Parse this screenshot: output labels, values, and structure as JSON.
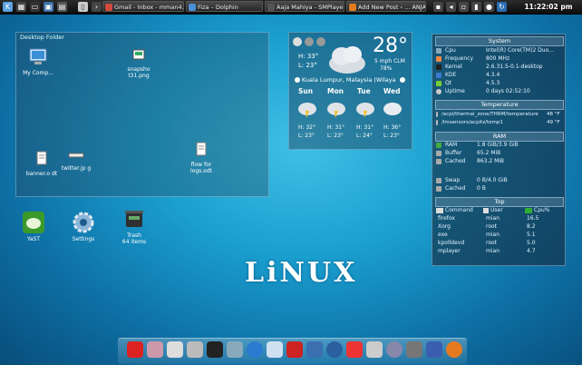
{
  "taskbar": {
    "tasks": [
      {
        "label": "Gmail - Inbox - mman4...",
        "color": "#d04a3a"
      },
      {
        "label": "Fiza – Dolphin",
        "color": "#4a90d9"
      },
      {
        "label": "Aaja Mahiya - SMPlayer",
        "color": "#3a3a3a"
      },
      {
        "label": "Add New Post ‹ ... ANJA",
        "color": "#e07a20"
      }
    ],
    "clock": "11:22:02 pm"
  },
  "folder": {
    "title": "Desktop Folder",
    "items": [
      {
        "label": "My Comp...",
        "icon": "computer-icon"
      },
      {
        "label": "snapsho t31.png",
        "icon": "image-file-icon"
      },
      {
        "label": "banner.o dt",
        "icon": "document-icon"
      },
      {
        "label": "twitter.jp g",
        "icon": "image-file-icon"
      },
      {
        "label": "flow for logs.odt",
        "icon": "document-icon"
      }
    ]
  },
  "weather": {
    "temp": "28°",
    "high": "H: 33°",
    "low": "L: 23°",
    "wind": "5 mph CLM",
    "humidity": "78%",
    "location": "Kuala Lumpur, Malaysia (Wilaya",
    "days": [
      {
        "name": "Sun",
        "high": "H: 32°",
        "low": "L: 23°"
      },
      {
        "name": "Mon",
        "high": "H: 31°",
        "low": "L: 23°"
      },
      {
        "name": "Tue",
        "high": "H: 31°",
        "low": "L: 24°"
      },
      {
        "name": "Wed",
        "high": "H: 36°",
        "low": "L: 23°"
      }
    ]
  },
  "sysmon": {
    "system_title": "System",
    "system": [
      {
        "k": "Cpu",
        "v": "Intel(R) Core(TM)2 Duo..."
      },
      {
        "k": "Frequency",
        "v": "800 MHz"
      },
      {
        "k": "Kernel",
        "v": "2.6.31.5-0.1-desktop"
      },
      {
        "k": "KDE",
        "v": "4.3.4"
      },
      {
        "k": "Qt",
        "v": "4.5.3"
      },
      {
        "k": "Uptime",
        "v": "0 days 02:52:10"
      }
    ],
    "temp_title": "Temperature",
    "temps": [
      {
        "k": "/acpi/thermal_zone/THRM/temperature",
        "v": "48 °F"
      },
      {
        "k": "/lmsensors/acpitz/temp1",
        "v": "49 °F"
      }
    ],
    "ram_title": "RAM",
    "ram": [
      {
        "k": "RAM",
        "v": "1.8 GiB/3.9 GiB"
      },
      {
        "k": "Buffer",
        "v": "65.2 MiB"
      },
      {
        "k": "Cached",
        "v": "863.2 MiB"
      }
    ],
    "swap": [
      {
        "k": "Swap",
        "v": "0 B/4.0 GiB"
      },
      {
        "k": "Cached",
        "v": "0 B"
      }
    ],
    "top_title": "Top",
    "top_headers": {
      "cmd": "Command",
      "user": "User",
      "cpu": "Cpu%"
    },
    "top": [
      {
        "cmd": "firefox",
        "user": "mian",
        "cpu": "16.5"
      },
      {
        "cmd": "Xorg",
        "user": "root",
        "cpu": "8.2"
      },
      {
        "cmd": "exe",
        "user": "mian",
        "cpu": "5.1"
      },
      {
        "cmd": "kpolldevd",
        "user": "root",
        "cpu": "5.0"
      },
      {
        "cmd": "mplayer",
        "user": "mian",
        "cpu": "4.7"
      }
    ]
  },
  "desktop": {
    "yast": "YaST",
    "settings": "Settings",
    "trash": "Trash",
    "trash_count": "64 items"
  },
  "wallpaper_text": "LiNUX"
}
